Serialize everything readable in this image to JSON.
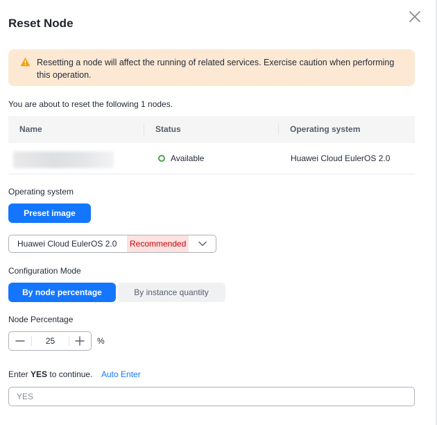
{
  "dialog": {
    "title": "Reset Node",
    "close_icon": "close-icon"
  },
  "warning": {
    "icon": "warning-triangle-icon",
    "text": "Resetting a node will affect the running of related services. Exercise caution when performing this operation.",
    "background": "#fde9d3",
    "icon_color": "#f59e0b"
  },
  "intro": "You are about to reset the following 1 nodes.",
  "table": {
    "headers": [
      "Name",
      "Status",
      "Operating system"
    ],
    "rows": [
      {
        "name": "",
        "status": "Available",
        "status_color": "#50a14f",
        "os": "Huawei Cloud EulerOS 2.0"
      }
    ]
  },
  "os_section": {
    "label": "Operating system",
    "preset_button": "Preset image",
    "select_value": "Huawei Cloud EulerOS 2.0",
    "select_tag": "Recommended"
  },
  "config_mode": {
    "label": "Configuration Mode",
    "options": [
      "By node percentage",
      "By instance quantity"
    ],
    "selected": "By node percentage"
  },
  "node_percentage": {
    "label": "Node Percentage",
    "value": "25",
    "unit": "%"
  },
  "confirm": {
    "prefix": "Enter",
    "keyword": "YES",
    "suffix": "to continue.",
    "auto_enter": "Auto Enter",
    "placeholder": "YES"
  },
  "colors": {
    "primary": "#1476ff",
    "danger_text": "#c7000b",
    "danger_bg": "#fde2e0"
  }
}
